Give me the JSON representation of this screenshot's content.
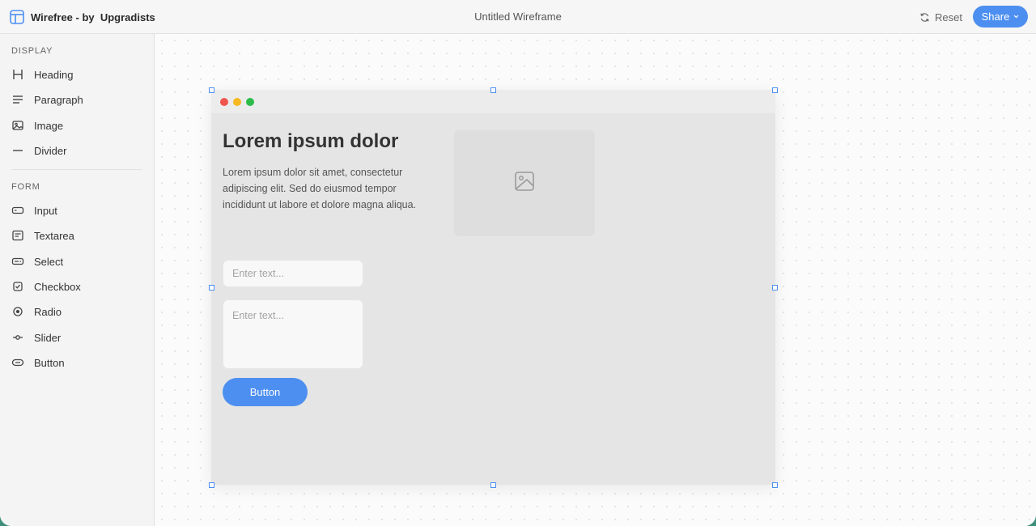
{
  "header": {
    "brand": "Wirefree - by  Upgradists",
    "document_title": "Untitled Wireframe",
    "reset_label": "Reset",
    "share_label": "Share",
    "accent_color": "#4d8ff0"
  },
  "sidebar": {
    "display_label": "DISPLAY",
    "display_items": [
      {
        "label": "Heading",
        "icon": "heading-icon"
      },
      {
        "label": "Paragraph",
        "icon": "paragraph-icon"
      },
      {
        "label": "Image",
        "icon": "image-icon"
      },
      {
        "label": "Divider",
        "icon": "divider-icon"
      }
    ],
    "form_label": "FORM",
    "form_items": [
      {
        "label": "Input",
        "icon": "input-icon"
      },
      {
        "label": "Textarea",
        "icon": "textarea-icon"
      },
      {
        "label": "Select",
        "icon": "select-icon"
      },
      {
        "label": "Checkbox",
        "icon": "checkbox-icon"
      },
      {
        "label": "Radio",
        "icon": "radio-icon"
      },
      {
        "label": "Slider",
        "icon": "slider-icon"
      },
      {
        "label": "Button",
        "icon": "button-icon"
      }
    ]
  },
  "wireframe": {
    "heading": "Lorem ipsum dolor",
    "paragraph": "Lorem ipsum dolor sit amet, consectetur adipiscing elit. Sed do eiusmod tempor incididunt ut labore et dolore magna aliqua.",
    "image_placeholder_icon": "image-icon",
    "input_placeholder": "Enter text...",
    "textarea_placeholder": "Enter text...",
    "button_label": "Button",
    "window_dots": [
      "#f0564f",
      "#f6b823",
      "#2dbc4c"
    ]
  }
}
